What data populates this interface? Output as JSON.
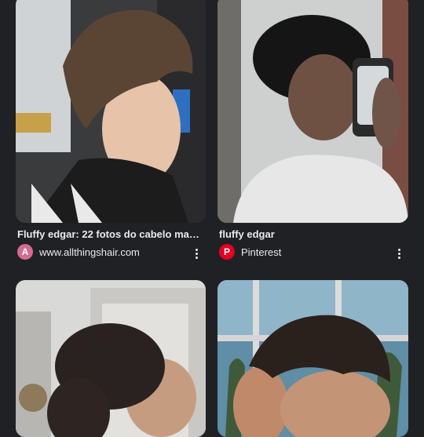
{
  "results": [
    {
      "title": "Fluffy edgar: 22 fotos do cabelo masc...",
      "source": "www.allthingshair.com",
      "favicon": "allthingshair-logo",
      "favicon_letter": "A",
      "favicon_color": "#d16d8f"
    },
    {
      "title": "fluffy edgar",
      "source": "Pinterest",
      "favicon": "pinterest-logo",
      "favicon_letter": "P",
      "favicon_color": "#e60023"
    }
  ],
  "colors": {
    "background": "#202124",
    "text": "#e8eaed"
  }
}
